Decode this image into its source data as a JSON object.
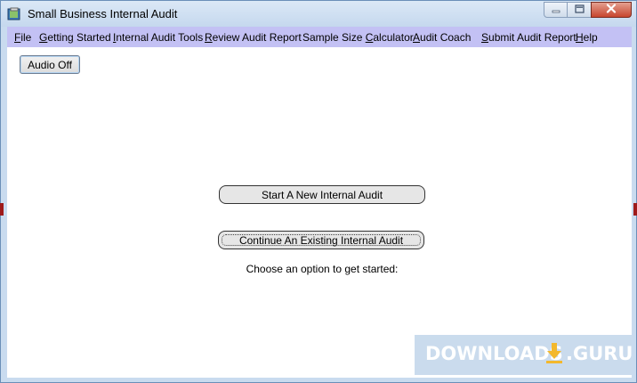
{
  "window": {
    "title": "Small Business Internal Audit",
    "controls": {
      "minimize": "minimize-icon",
      "maximize": "maximize-icon",
      "close": "close-icon"
    }
  },
  "menu": {
    "items": [
      {
        "id": "file",
        "prefix": "",
        "mnemonic": "F",
        "rest": "ile"
      },
      {
        "id": "getting-started",
        "prefix": "",
        "mnemonic": "G",
        "rest": "etting Started"
      },
      {
        "id": "internal-audit-tools",
        "prefix": "",
        "mnemonic": "I",
        "rest": "nternal Audit Tools"
      },
      {
        "id": "review-audit-report",
        "prefix": "",
        "mnemonic": "R",
        "rest": "eview Audit Report"
      },
      {
        "id": "sample-size-calculator",
        "prefix": "Sample Size ",
        "mnemonic": "C",
        "rest": "alculator"
      },
      {
        "id": "audit-coach",
        "prefix": "",
        "mnemonic": "A",
        "rest": "udit Coach"
      },
      {
        "id": "submit-audit-report",
        "prefix": "",
        "mnemonic": "S",
        "rest": "ubmit Audit Report"
      },
      {
        "id": "help",
        "prefix": "",
        "mnemonic": "H",
        "rest": "elp"
      }
    ]
  },
  "content": {
    "audio_button": "Audio Off",
    "new_audit_button": "Start A New Internal Audit",
    "continue_audit_button": "Continue An Existing Internal Audit",
    "prompt": "Choose an option to get started:"
  },
  "watermark": {
    "left_text": "DOWNLOADS",
    "right_text": ".GURU",
    "icon": "download-arrow-icon"
  },
  "colors": {
    "menubar": "#c3c1f4",
    "titlebar": "#c9dbef",
    "close_button": "#c7452e",
    "watermark_accent": "#f2b21c"
  }
}
